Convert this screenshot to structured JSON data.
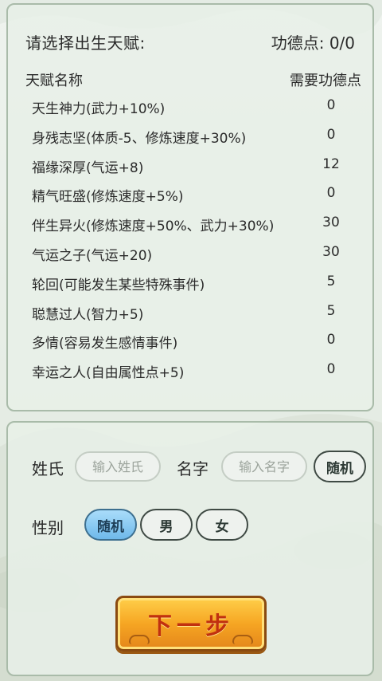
{
  "header": {
    "prompt": "请选择出生天赋:",
    "merit_label": "功德点:",
    "merit_value": "0/0"
  },
  "talent_table": {
    "name_header": "天赋名称",
    "cost_header": "需要功德点",
    "rows": [
      {
        "name": "天生神力(武力+10%)",
        "cost": "0"
      },
      {
        "name": "身残志坚(体质-5、修炼速度+30%)",
        "cost": "0"
      },
      {
        "name": "福缘深厚(气运+8)",
        "cost": "12"
      },
      {
        "name": "精气旺盛(修炼速度+5%)",
        "cost": "0"
      },
      {
        "name": "伴生异火(修炼速度+50%、武力+30%)",
        "cost": "30"
      },
      {
        "name": "气运之子(气运+20)",
        "cost": "30"
      },
      {
        "name": "轮回(可能发生某些特殊事件)",
        "cost": "5"
      },
      {
        "name": "聪慧过人(智力+5)",
        "cost": "5"
      },
      {
        "name": "多情(容易发生感情事件)",
        "cost": "0"
      },
      {
        "name": "幸运之人(自由属性点+5)",
        "cost": "0"
      }
    ]
  },
  "form": {
    "surname_label": "姓氏",
    "surname_placeholder": "输入姓氏",
    "surname_value": "",
    "given_name_label": "名字",
    "given_name_placeholder": "输入名字",
    "given_name_value": "",
    "random_name_label": "随机",
    "gender_label": "性别",
    "gender_options": [
      "随机",
      "男",
      "女"
    ],
    "gender_selected": "随机"
  },
  "next_button_label": "下一步",
  "colors": {
    "panel_border": "#a9bba9",
    "selected_gender": "#6fb9ea",
    "next_button": "#f6a623",
    "next_button_text": "#c1300f"
  }
}
